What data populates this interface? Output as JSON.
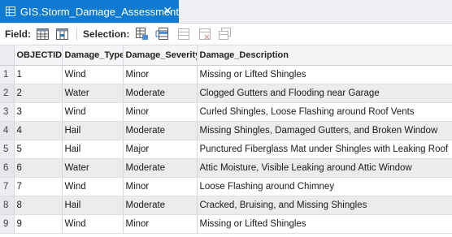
{
  "tab": {
    "title": "GIS.Storm_Damage_Assessment",
    "close_glyph": "✕"
  },
  "toolbar": {
    "field_label": "Field:",
    "selection_label": "Selection:",
    "field_icons": [
      "add-field-icon",
      "calculate-field-icon"
    ],
    "selection_icons": [
      "select-by-attributes-icon",
      "switch-selection-icon",
      "clear-selection-icon",
      "delete-selected-icon",
      "copy-selected-icon"
    ]
  },
  "table": {
    "headers": [
      "",
      "OBJECTID *",
      "Damage_Type",
      "Damage_Severity",
      "Damage_Description"
    ],
    "rows": [
      {
        "n": "1",
        "id": "1",
        "type": "Wind",
        "severity": "Minor",
        "description": "Missing or Lifted Shingles"
      },
      {
        "n": "2",
        "id": "2",
        "type": "Water",
        "severity": "Moderate",
        "description": "Clogged Gutters and Flooding near Garage"
      },
      {
        "n": "3",
        "id": "3",
        "type": "Wind",
        "severity": "Minor",
        "description": "Curled Shingles, Loose Flashing around Roof Vents"
      },
      {
        "n": "4",
        "id": "4",
        "type": "Hail",
        "severity": "Moderate",
        "description": "Missing Shingles, Damaged Gutters, and Broken Window"
      },
      {
        "n": "5",
        "id": "5",
        "type": "Hail",
        "severity": "Major",
        "description": "Punctured Fiberglass Mat under Shingles with Leaking Roof"
      },
      {
        "n": "6",
        "id": "6",
        "type": "Water",
        "severity": "Moderate",
        "description": "Attic Moisture, Visible Leaking around Attic Window"
      },
      {
        "n": "7",
        "id": "7",
        "type": "Wind",
        "severity": "Minor",
        "description": "Loose Flashing around Chimney"
      },
      {
        "n": "8",
        "id": "8",
        "type": "Hail",
        "severity": "Moderate",
        "description": "Cracked, Bruising, and Missing Shingles"
      },
      {
        "n": "9",
        "id": "9",
        "type": "Wind",
        "severity": "Minor",
        "description": "Missing or Lifted Shingles"
      }
    ]
  },
  "colors": {
    "accent": "#0e7ad1",
    "alt_row": "#ececec"
  }
}
